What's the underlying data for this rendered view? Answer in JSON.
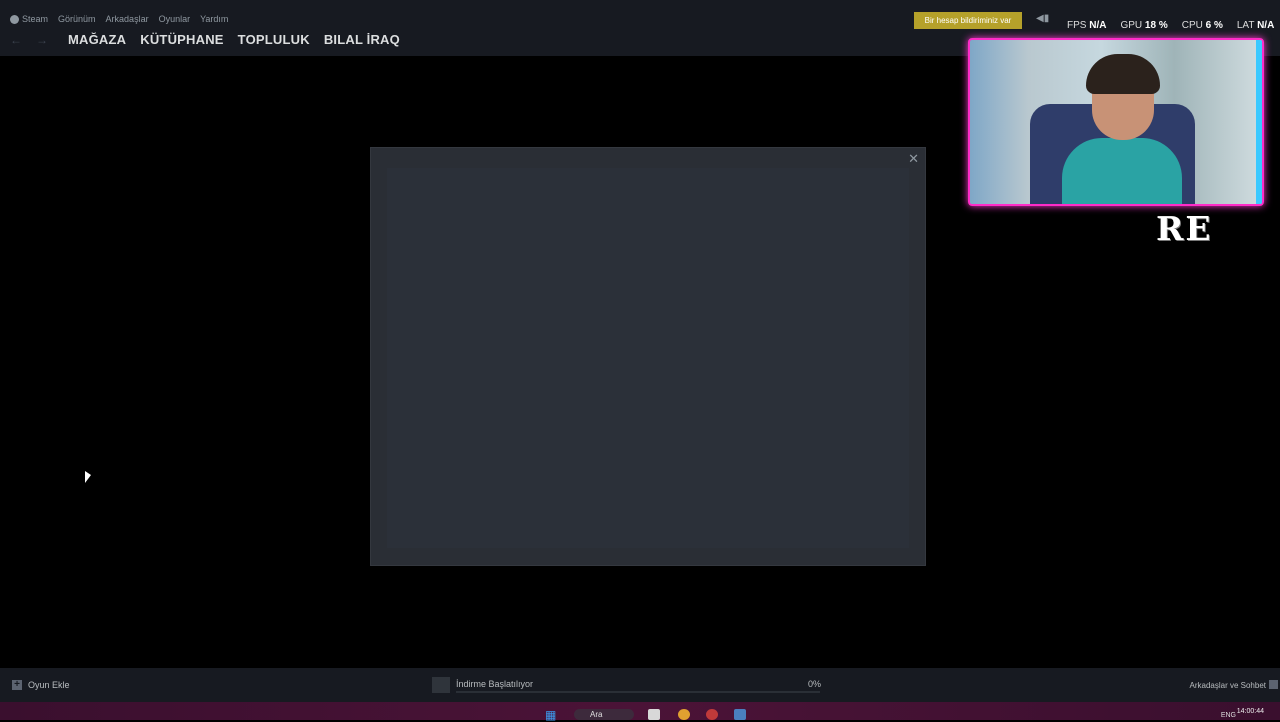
{
  "menu": {
    "items": [
      "Steam",
      "Görünüm",
      "Arkadaşlar",
      "Oyunlar",
      "Yardım"
    ]
  },
  "nav": {
    "back_icon": "chevron-left-icon",
    "forward_icon": "chevron-right-icon",
    "links": [
      "MAĞAZA",
      "KÜTÜPHANE",
      "TOPLULUK",
      "BILAL İRAQ"
    ]
  },
  "header": {
    "notice_label": "Bir hesap bildiriminiz var",
    "speaker_icon": "megaphone-icon"
  },
  "stats": {
    "fps_label": "FPS",
    "fps_value": "N/A",
    "gpu_label": "GPU",
    "gpu_value": "18 %",
    "cpu_label": "CPU",
    "cpu_value": "6 %",
    "lat_label": "LAT",
    "lat_value": "N/A"
  },
  "modal": {
    "close_icon": "close-icon"
  },
  "overlay": {
    "rec_text": "RE"
  },
  "status": {
    "add_game_label": "Oyun Ekle",
    "download_label": "İndirme Başlatılıyor",
    "download_percent": "0%",
    "download_progress": 0,
    "friends_label": "Arkadaşlar ve Sohbet"
  },
  "taskbar": {
    "search_label": "Ara",
    "language": "ENG",
    "time": "14:00:44"
  },
  "colors": {
    "notice_bg": "#b5a12a",
    "webcam_border": "#ff2cc8",
    "progress": "#1a9fff"
  }
}
